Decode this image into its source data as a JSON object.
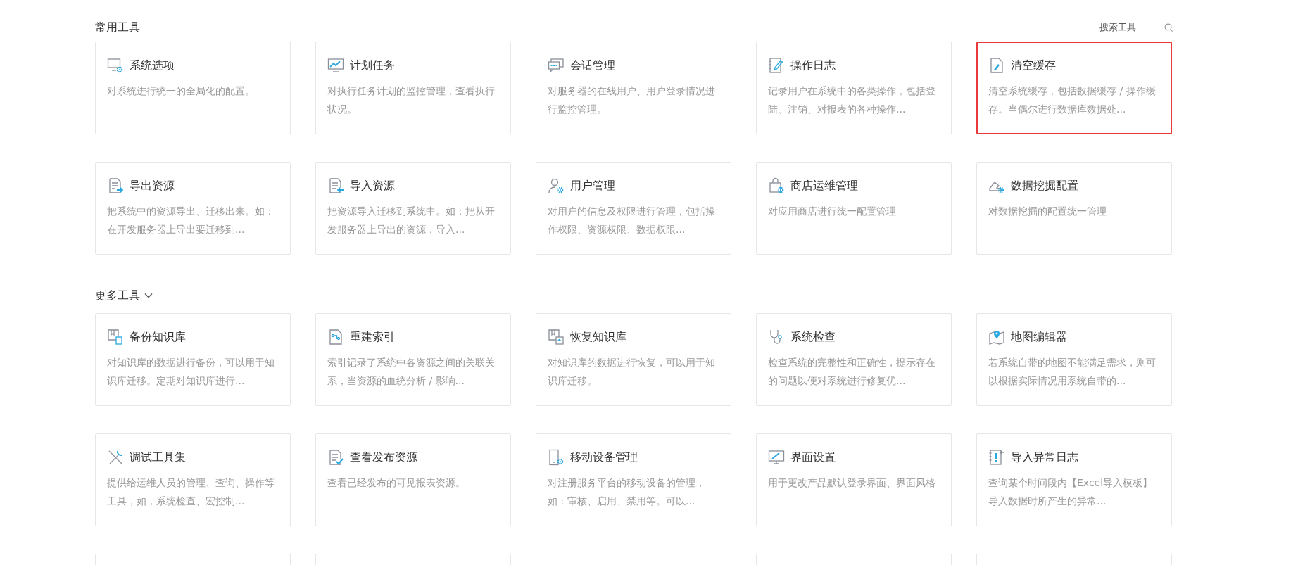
{
  "search": {
    "label": "搜索工具"
  },
  "sections": [
    {
      "title": "常用工具",
      "cards": [
        {
          "title": "系统选项",
          "description": "对系统进行统一的全局化的配置。",
          "selected": false
        },
        {
          "title": "计划任务",
          "description": "对执行任务计划的监控管理，查看执行状况。",
          "selected": false
        },
        {
          "title": "会话管理",
          "description": "对服务器的在线用户、用户登录情况进行监控管理。",
          "selected": false
        },
        {
          "title": "操作日志",
          "description": "记录用户在系统中的各类操作，包括登陆、注销、对报表的各种操作...",
          "selected": false
        },
        {
          "title": "清空缓存",
          "description": "清空系统缓存，包括数据缓存 / 操作缓存。当偶尔进行数据库数据处...",
          "selected": true
        },
        {
          "title": "导出资源",
          "description": "把系统中的资源导出、迁移出来。如：在开发服务器上导出要迁移到...",
          "selected": false
        },
        {
          "title": "导入资源",
          "description": "把资源导入迁移到系统中。如：把从开发服务器上导出的资源，导入...",
          "selected": false
        },
        {
          "title": "用户管理",
          "description": "对用户的信息及权限进行管理，包括操作权限、资源权限、数据权限...",
          "selected": false
        },
        {
          "title": "商店运维管理",
          "description": "对应用商店进行统一配置管理",
          "selected": false
        },
        {
          "title": "数据挖掘配置",
          "description": "对数据挖掘的配置统一管理",
          "selected": false
        }
      ]
    },
    {
      "title": "更多工具",
      "expanded": true,
      "cards": [
        {
          "title": "备份知识库",
          "description": "对知识库的数据进行备份，可以用于知识库迁移。定期对知识库进行...",
          "selected": false
        },
        {
          "title": "重建索引",
          "description": "索引记录了系统中各资源之间的关联关系，当资源的血统分析 / 影响...",
          "selected": false
        },
        {
          "title": "恢复知识库",
          "description": "对知识库的数据进行恢复，可以用于知识库迁移。",
          "selected": false
        },
        {
          "title": "系统检查",
          "description": "检查系统的完整性和正确性，提示存在的问题以便对系统进行修复优...",
          "selected": false
        },
        {
          "title": "地图编辑器",
          "description": "若系统自带的地图不能满足需求，则可以根据实际情况用系统自带的...",
          "selected": false
        },
        {
          "title": "调试工具集",
          "description": "提供给运维人员的管理、查询、操作等工具，如，系统检查、宏控制...",
          "selected": false
        },
        {
          "title": "查看发布资源",
          "description": "查看已经发布的可见报表资源。",
          "selected": false
        },
        {
          "title": "移动设备管理",
          "description": "对注册服务平台的移动设备的管理，如：审核、启用、禁用等。可以...",
          "selected": false
        },
        {
          "title": "界面设置",
          "description": "用于更改产品默认登录界面、界面风格",
          "selected": false
        },
        {
          "title": "导入异常日志",
          "description": "查询某个时间段内【Excel导入模板】导入数据时所产生的异常...",
          "selected": false
        }
      ]
    }
  ]
}
